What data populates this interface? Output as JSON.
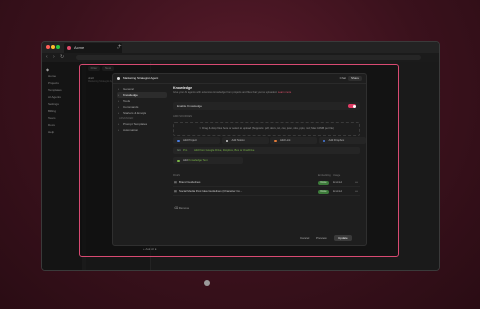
{
  "browser": {
    "tab_title": "Acme",
    "new_tab": "+",
    "close": "×",
    "nav_icons": [
      "arrow-left-icon",
      "arrow-right-icon",
      "reload-icon"
    ]
  },
  "app": {
    "sidebar_items": [
      "Home",
      "Projects",
      "Templates",
      "AI Agents",
      "Settings",
      "Billing",
      "Team",
      "Docs",
      "Help"
    ],
    "list_item_title": "draft",
    "list_item_sub": "Marketing Strategist Agent",
    "new_button": "New",
    "filter_button": "Filter"
  },
  "modal": {
    "title": "Marketing Strategist Agent",
    "chat_label": "Chat",
    "share_label": "Share",
    "nav": [
      {
        "label": "General",
        "icon": "info-icon",
        "selected": false
      },
      {
        "label": "Knowledge",
        "icon": "book-icon",
        "selected": true
      },
      {
        "label": "Tools",
        "icon": "wrench-icon",
        "selected": false
      },
      {
        "label": "Commands",
        "icon": "command-icon",
        "selected": false
      },
      {
        "label": "Starters & Emojis",
        "icon": "smile-icon",
        "selected": false
      }
    ],
    "nav_section": "ADVANCED",
    "nav_advanced": [
      {
        "label": "Prompt Templates",
        "icon": "template-icon"
      },
      {
        "label": "Automation",
        "icon": "bolt-icon"
      }
    ],
    "knowledge": {
      "heading": "Knowledge",
      "description": "Give your AI agents with extensive knowledge from projects and files that you've uploaded.",
      "learn_more": "Learn more",
      "enable_label": "Enable Knowledge",
      "enabled": true,
      "sources_label": "ADD SOURCES",
      "drop_text": "Drag & drop files here or select to upload (Supports: pdf, docx, txt, csv, json, xlsx, pptx, md; Max 10MB per file)",
      "sources": [
        {
          "label": "Add Project",
          "color": "#4a7de0"
        },
        {
          "label": "Add Notion",
          "color": "#cccccc"
        },
        {
          "label": "Add Link",
          "color": "#e07a3a"
        },
        {
          "label": "Add Dropbox",
          "color": "#4a7de0"
        }
      ],
      "git_prefix": "Git",
      "git_tag": "Pro",
      "git_text": "Add from Google Drive, Dropbox, Box or OneDrive",
      "add_text_prefix": "Add",
      "add_text_highlight": "Knowledge Text",
      "files_label": "FILES",
      "col_embedding": "Embedding",
      "col_status": "Usage",
      "files": [
        {
          "name": "Brand Guidelines",
          "pill": "Done",
          "status": "Enabled"
        },
        {
          "name": "Social Media Post Idea Guidelines (Character Co...",
          "pill": "Done",
          "status": "Enabled"
        }
      ],
      "remove_label": "Remove"
    },
    "footer": {
      "cancel": "Cancel",
      "preview": "Preview",
      "update": "Update"
    }
  },
  "composer": {
    "placeholder": "Ask AI"
  },
  "colors": {
    "accent": "#d84a72",
    "background": "#3a111c",
    "toggle_on": "#e03c64"
  }
}
